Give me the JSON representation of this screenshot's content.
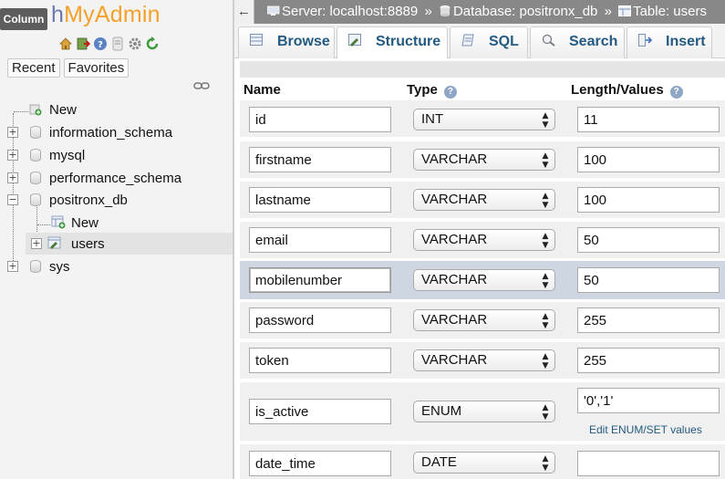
{
  "nav": {
    "tooltip": "Column",
    "logo_php": "php",
    "logo_rest": "MyAdmin",
    "logo_shown_prefix": "h",
    "recent_label": "Recent",
    "favorites_label": "Favorites",
    "quick_icons": [
      "home-icon",
      "exit-icon",
      "help-icon",
      "docs-icon",
      "settings-icon",
      "reload-icon"
    ],
    "tree": [
      {
        "label": "New",
        "kind": "new",
        "level": 0
      },
      {
        "label": "information_schema",
        "kind": "db",
        "level": 0
      },
      {
        "label": "mysql",
        "kind": "db",
        "level": 0
      },
      {
        "label": "performance_schema",
        "kind": "db",
        "level": 0
      },
      {
        "label": "positronx_db",
        "kind": "db",
        "level": 0,
        "expanded": true
      },
      {
        "label": "New",
        "kind": "new",
        "level": 1
      },
      {
        "label": "users",
        "kind": "table",
        "level": 1,
        "selected": true
      },
      {
        "label": "sys",
        "kind": "db",
        "level": 0
      }
    ]
  },
  "breadcrumb": {
    "back": "←",
    "server": "Server: localhost:8889",
    "database": "Database: positronx_db",
    "table": "Table: users",
    "sep": "»"
  },
  "tabs": [
    {
      "label": "Browse",
      "icon": "browse-icon"
    },
    {
      "label": "Structure",
      "icon": "structure-icon",
      "active": true
    },
    {
      "label": "SQL",
      "icon": "sql-icon"
    },
    {
      "label": "Search",
      "icon": "search-icon"
    },
    {
      "label": "Insert",
      "icon": "insert-icon"
    }
  ],
  "columns_header": {
    "name": "Name",
    "type": "Type",
    "length": "Length/Values",
    "help": "?"
  },
  "fields": [
    {
      "name": "id",
      "type": "INT",
      "length": "11"
    },
    {
      "name": "firstname",
      "type": "VARCHAR",
      "length": "100"
    },
    {
      "name": "lastname",
      "type": "VARCHAR",
      "length": "100"
    },
    {
      "name": "email",
      "type": "VARCHAR",
      "length": "50"
    },
    {
      "name": "mobilenumber",
      "type": "VARCHAR",
      "length": "50",
      "highlighted": true
    },
    {
      "name": "password",
      "type": "VARCHAR",
      "length": "255"
    },
    {
      "name": "token",
      "type": "VARCHAR",
      "length": "255"
    },
    {
      "name": "is_active",
      "type": "ENUM",
      "length": "'0','1'",
      "edit_link": "Edit ENUM/SET values"
    },
    {
      "name": "date_time",
      "type": "DATE",
      "length": ""
    }
  ],
  "select_arrow": "▲▼",
  "colors": {
    "accent_link": "#235a81",
    "logo_orange": "#f4a12a",
    "logo_blue": "#6c78af",
    "highlight_row": "#ced6e2"
  }
}
